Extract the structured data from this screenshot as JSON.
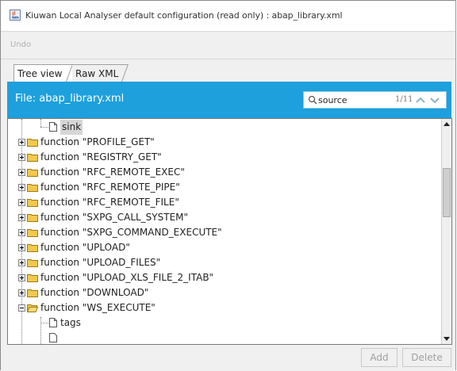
{
  "window": {
    "title": "Kiuwan Local Analyser default configuration (read only) : abap_library.xml"
  },
  "menu": {
    "undo_label": "Undo"
  },
  "tabs": [
    {
      "label": "Tree view",
      "active": true
    },
    {
      "label": "Raw XML",
      "active": false
    }
  ],
  "file_bar": {
    "label": "File: abap_library.xml",
    "accent_color": "#1ea0dc"
  },
  "search": {
    "value": "source",
    "match_counter": "1/11"
  },
  "tree": {
    "rows": [
      {
        "label": "sink",
        "icon": "document-icon",
        "selected": true
      },
      {
        "label": "function \"PROFILE_GET\"",
        "icon": "folder-icon",
        "expanded": false
      },
      {
        "label": "function \"REGISTRY_GET\"",
        "icon": "folder-icon",
        "expanded": false
      },
      {
        "label": "function \"RFC_REMOTE_EXEC\"",
        "icon": "folder-icon",
        "expanded": false
      },
      {
        "label": "function \"RFC_REMOTE_PIPE\"",
        "icon": "folder-icon",
        "expanded": false
      },
      {
        "label": "function \"RFC_REMOTE_FILE\"",
        "icon": "folder-icon",
        "expanded": false
      },
      {
        "label": "function \"SXPG_CALL_SYSTEM\"",
        "icon": "folder-icon",
        "expanded": false
      },
      {
        "label": "function \"SXPG_COMMAND_EXECUTE\"",
        "icon": "folder-icon",
        "expanded": false
      },
      {
        "label": "function \"UPLOAD\"",
        "icon": "folder-icon",
        "expanded": false
      },
      {
        "label": "function \"UPLOAD_FILES\"",
        "icon": "folder-icon",
        "expanded": false
      },
      {
        "label": "function \"UPLOAD_XLS_FILE_2_ITAB\"",
        "icon": "folder-icon",
        "expanded": false
      },
      {
        "label": "function \"DOWNLOAD\"",
        "icon": "folder-icon",
        "expanded": false
      },
      {
        "label": "function \"WS_EXECUTE\"",
        "icon": "open-folder-icon",
        "expanded": true
      },
      {
        "label": "tags",
        "icon": "document-icon",
        "selected": false
      }
    ]
  },
  "buttons": {
    "add_label": "Add",
    "delete_label": "Delete"
  }
}
